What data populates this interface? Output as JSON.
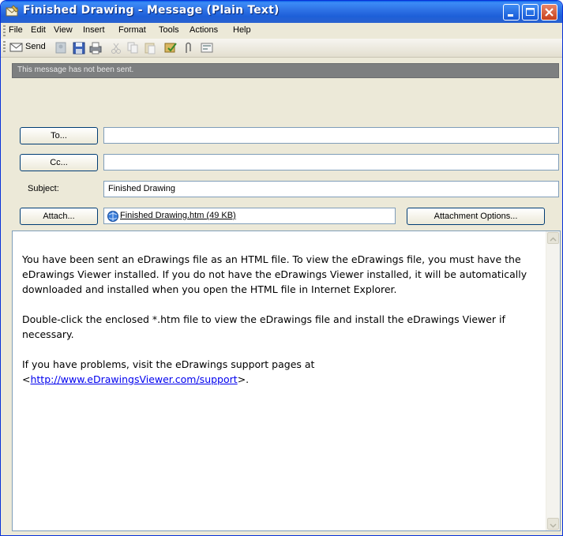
{
  "window": {
    "title": "Finished Drawing - Message (Plain Text)"
  },
  "menu": [
    "File",
    "Edit",
    "View",
    "Insert",
    "Format",
    "Tools",
    "Actions",
    "Help"
  ],
  "toolbar": {
    "send_label": "Send",
    "icons": [
      "send-icon",
      "address-book-icon",
      "save-icon",
      "print-icon",
      "cut-icon",
      "copy-icon",
      "paste-icon",
      "check-names-icon",
      "attach-icon",
      "options-icon"
    ]
  },
  "info_bar": "This message has not been sent.",
  "header": {
    "to_button": "To...",
    "to_value": "",
    "cc_button": "Cc...",
    "cc_value": "",
    "subject_label": "Subject:",
    "subject_value": "Finished Drawing",
    "attach_button": "Attach...",
    "attachment_name": "Finished Drawing.htm (49 KB)",
    "attachment_options_button": "Attachment Options..."
  },
  "body": {
    "para1": "You have been sent an eDrawings file as an HTML file. To view the eDrawings file, you must have the eDrawings Viewer installed. If you do not have the eDrawings Viewer installed, it will be automatically downloaded and installed when you open the HTML file in Internet Explorer.",
    "para2": "Double-click the enclosed *.htm file to view the eDrawings file and install the eDrawings Viewer if necessary.",
    "para3_prefix": "If you have problems, visit the eDrawings support pages at",
    "para3_lt": "<",
    "para3_link": "http://www.eDrawingsViewer.com/support",
    "para3_gt": ">."
  },
  "colors": {
    "titlebar": "#2f73e6",
    "infobar": "#7d7f80",
    "close_button": "#c8411b",
    "link": "#0000ee"
  }
}
